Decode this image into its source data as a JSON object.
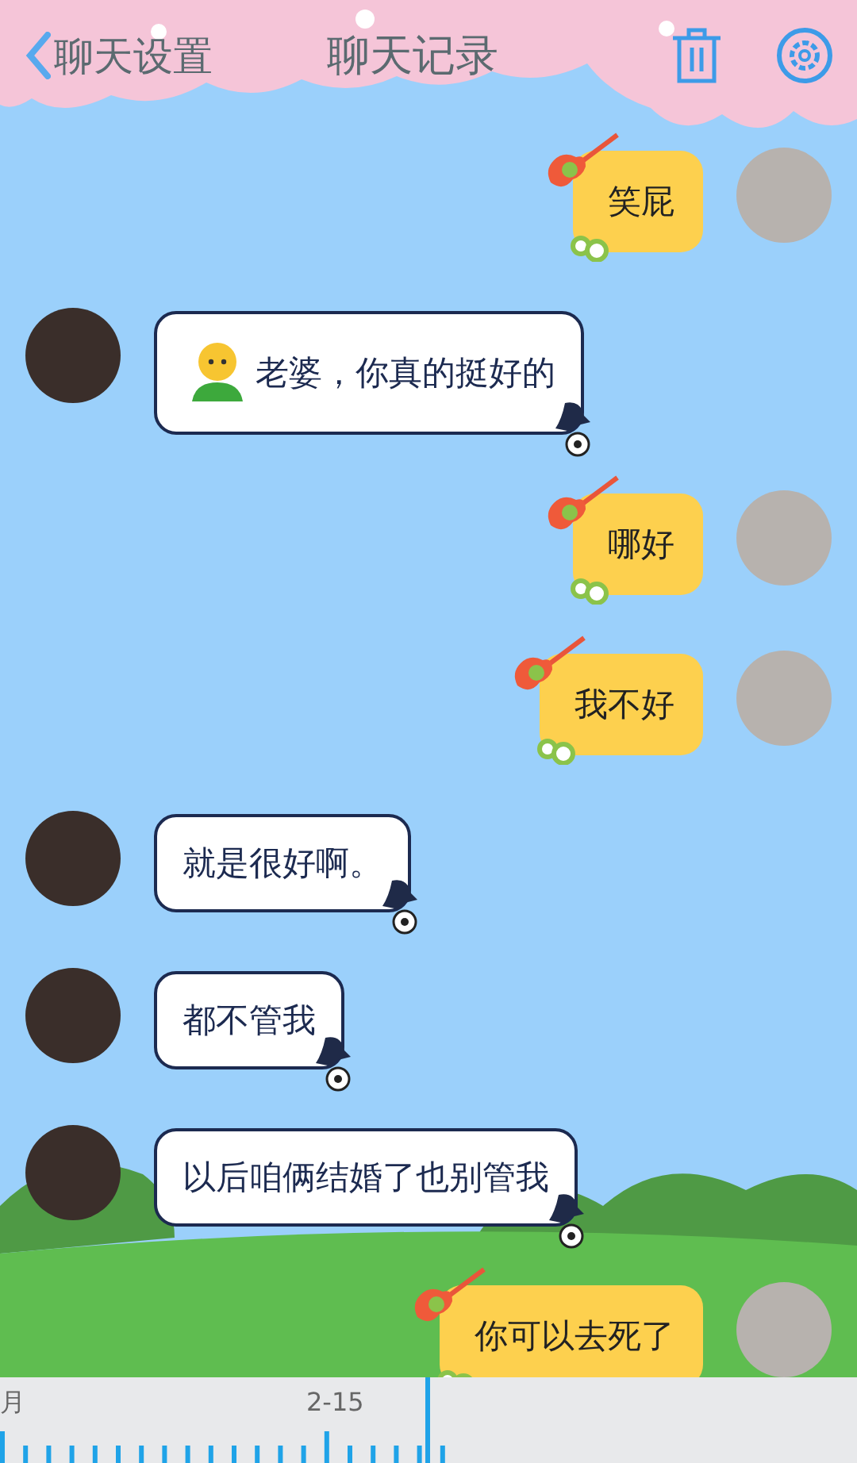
{
  "top_bar": {
    "back_label": "聊天设置",
    "title": "聊天记录"
  },
  "messages": [
    {
      "kind": "sent",
      "text": "笑屁"
    },
    {
      "kind": "received",
      "text": "老婆，你真的挺好的",
      "emoji": true
    },
    {
      "kind": "sent",
      "text": "哪好"
    },
    {
      "kind": "sent",
      "text": "我不好"
    },
    {
      "kind": "received",
      "text": "就是很好啊。",
      "emoji": false
    },
    {
      "kind": "received",
      "text": "都不管我",
      "emoji": false
    },
    {
      "kind": "received",
      "text": "以后咱俩结婚了也别管我",
      "emoji": false
    },
    {
      "kind": "sent",
      "text": "你可以去死了"
    }
  ],
  "timeline": {
    "labels": [
      "月",
      "2-15"
    ]
  }
}
